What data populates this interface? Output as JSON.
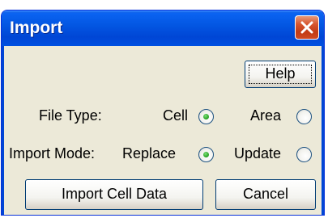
{
  "window": {
    "title": "Import"
  },
  "buttons": {
    "help": "Help",
    "import_cell_data": "Import Cell Data",
    "cancel": "Cancel"
  },
  "file_type": {
    "label": "File Type:",
    "options": [
      {
        "label": "Cell",
        "selected": true
      },
      {
        "label": "Area",
        "selected": false
      }
    ]
  },
  "import_mode": {
    "label": "Import Mode:",
    "options": [
      {
        "label": "Replace",
        "selected": true
      },
      {
        "label": "Update",
        "selected": false
      }
    ]
  },
  "icons": {
    "close": "close-icon",
    "radio_selected": "radio-selected-icon"
  },
  "colors": {
    "title_bar": "#0054e3",
    "close_button": "#c8401a",
    "dialog_face": "#ece9d8",
    "radio_dot": "#2fa82a"
  }
}
